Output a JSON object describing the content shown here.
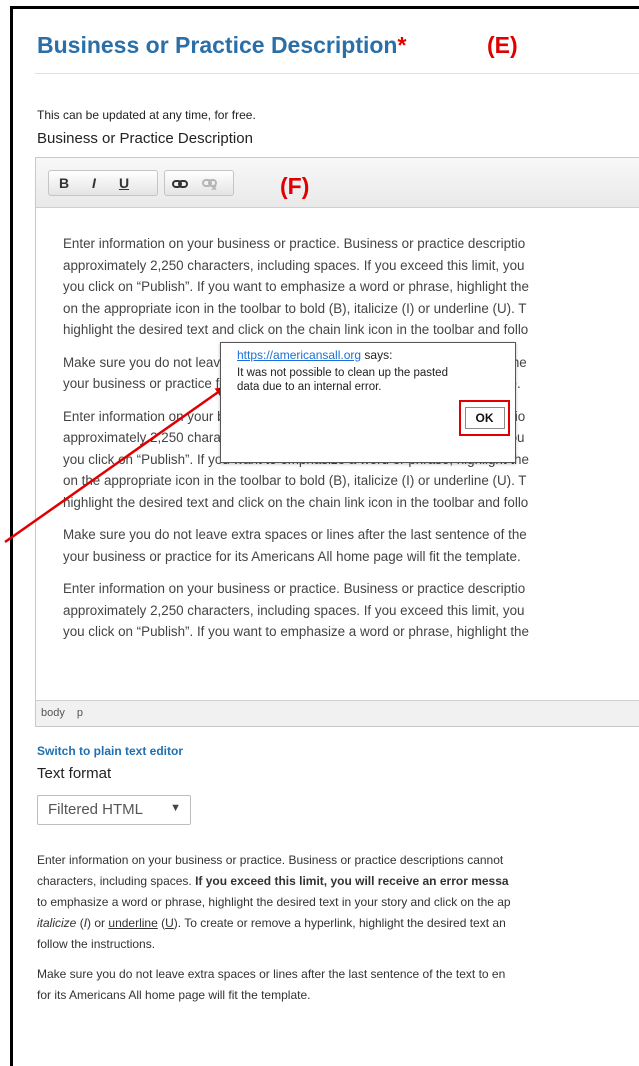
{
  "header": {
    "title": "Business or Practice Description",
    "required_mark": "*"
  },
  "annotations": {
    "marker_e": "(E)",
    "marker_f": "(F)"
  },
  "help_top": "This can be updated at any time, for free.",
  "field_label": "Business or Practice Description",
  "toolbar": {
    "bold": "B",
    "italic": "I",
    "underline": "U",
    "link_icon": "link-icon",
    "unlink_icon": "unlink-icon"
  },
  "editor": {
    "paragraphs": [
      [
        "Enter information on your business or practice. Business or practice descriptio",
        "approximately 2,250 characters, including spaces. If you exceed this limit, you",
        "you click on “Publish”. If you want to emphasize a word or phrase, highlight the",
        "on the appropriate icon in the toolbar to bold (B), italicize (I) or underline (U). T",
        "highlight the desired text and click on the chain link icon in the toolbar and follo"
      ],
      [
        "Make sure you do not leave extra spaces or lines after the last sentence of the",
        "your business or practice for its Americans All home page will fit the template."
      ],
      [
        "Enter information on your business or practice. Business or practice descriptio",
        "approximately 2,250 characters, including spaces. If you exceed this limit, you",
        "you click on “Publish”. If you want to emphasize a word or phrase, highlight the",
        "on the appropriate icon in the toolbar to bold (B), italicize (I) or underline (U). T",
        "highlight the desired text and click on the chain link icon in the toolbar and follo"
      ],
      [
        "Make sure you do not leave extra spaces or lines after the last sentence of the",
        "your business or practice for its Americans All home page will fit the template."
      ],
      [
        "Enter information on your business or practice. Business or practice descriptio",
        "approximately 2,250 characters, including spaces. If you exceed this limit, you",
        "you click on “Publish”. If you want to emphasize a word or phrase, highlight the"
      ]
    ],
    "path": [
      "body",
      "p"
    ]
  },
  "dialog": {
    "origin_link": "https://americansall.org",
    "origin_suffix": " says:",
    "message": "It was not possible to clean up the pasted data due to an internal error.",
    "ok_label": "OK"
  },
  "switch_link": "Switch to plain text editor",
  "format_label": "Text format",
  "format_select": {
    "selected": "Filtered HTML"
  },
  "colors": {
    "title": "#2a6fa8",
    "annotation_red": "#e00000",
    "link": "#1f6fb0"
  }
}
